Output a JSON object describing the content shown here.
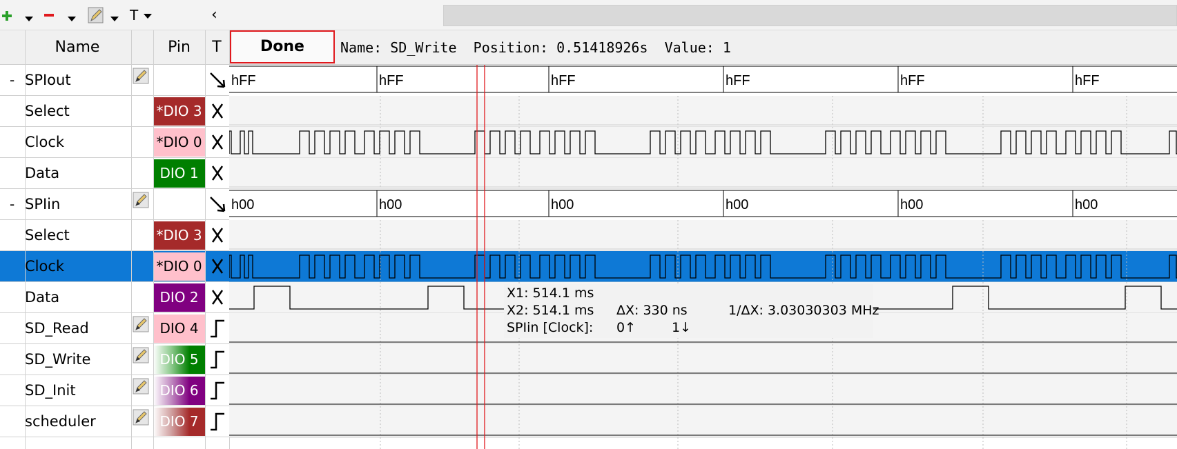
{
  "toolbar": {
    "add_label": "+",
    "remove_label": "−",
    "text_label": "T",
    "collapse_label": "‹"
  },
  "header": {
    "name": "Name",
    "pin": "Pin",
    "type": "T",
    "done": "Done",
    "info": "Name: SD_Write  Position: 0.51418926s  Value: 1"
  },
  "colors": {
    "selection": "#0e79d6",
    "cursor": "#e0191d",
    "dio_red": "#a52a2a",
    "dio_pink": "#ffc0cb",
    "dio_green": "#007f00",
    "dio_purple": "#800080"
  },
  "rows": [
    {
      "expand": "-",
      "name": "SPIout",
      "pin": "",
      "trigger": "arrow",
      "edit": true
    },
    {
      "expand": "",
      "name": "Select",
      "pin": "*DIO 3",
      "pin_color": "red",
      "trigger": "x"
    },
    {
      "expand": "",
      "name": "Clock",
      "pin": "*DIO 0",
      "pin_color": "pink",
      "trigger": "x"
    },
    {
      "expand": "",
      "name": "Data",
      "pin": "DIO 1",
      "pin_color": "green",
      "trigger": "x"
    },
    {
      "expand": "-",
      "name": "SPIin",
      "pin": "",
      "trigger": "arrow",
      "edit": true
    },
    {
      "expand": "",
      "name": "Select",
      "pin": "*DIO 3",
      "pin_color": "red",
      "trigger": "x"
    },
    {
      "expand": "",
      "name": "Clock",
      "pin": "*DIO 0",
      "pin_color": "pink",
      "trigger": "x",
      "selected": true
    },
    {
      "expand": "",
      "name": "Data",
      "pin": "DIO 2",
      "pin_color": "purple",
      "trigger": "x"
    },
    {
      "expand": "",
      "name": "SD_Read",
      "pin": "DIO 4",
      "pin_color": "pink",
      "trigger": "rise",
      "edit": true
    },
    {
      "expand": "",
      "name": "SD_Write",
      "pin": "DIO 5",
      "pin_color": "green-fade",
      "trigger": "rise",
      "edit": true
    },
    {
      "expand": "",
      "name": "SD_Init",
      "pin": "DIO 6",
      "pin_color": "purple-fade",
      "trigger": "rise",
      "edit": true
    },
    {
      "expand": "",
      "name": "scheduler",
      "pin": "DIO 7",
      "pin_color": "red-fade",
      "trigger": "rise",
      "edit": true
    }
  ],
  "bus_labels": {
    "spiout": [
      "hFF",
      "hFF",
      "hFF",
      "hFF",
      "hFF",
      "hFF"
    ],
    "spiin": [
      "h00",
      "h00",
      "h00",
      "h00",
      "h00",
      "h00"
    ]
  },
  "tooltip": {
    "x1": "X1: 514.1 ms",
    "x2": "X2: 514.1 ms",
    "dx": "ΔX: 330 ns",
    "inv_dx": "1/ΔX: 3.03030303 MHz",
    "channel": "SPIin [Clock]:",
    "rise_count": "0↑",
    "fall_count": "1↓"
  }
}
